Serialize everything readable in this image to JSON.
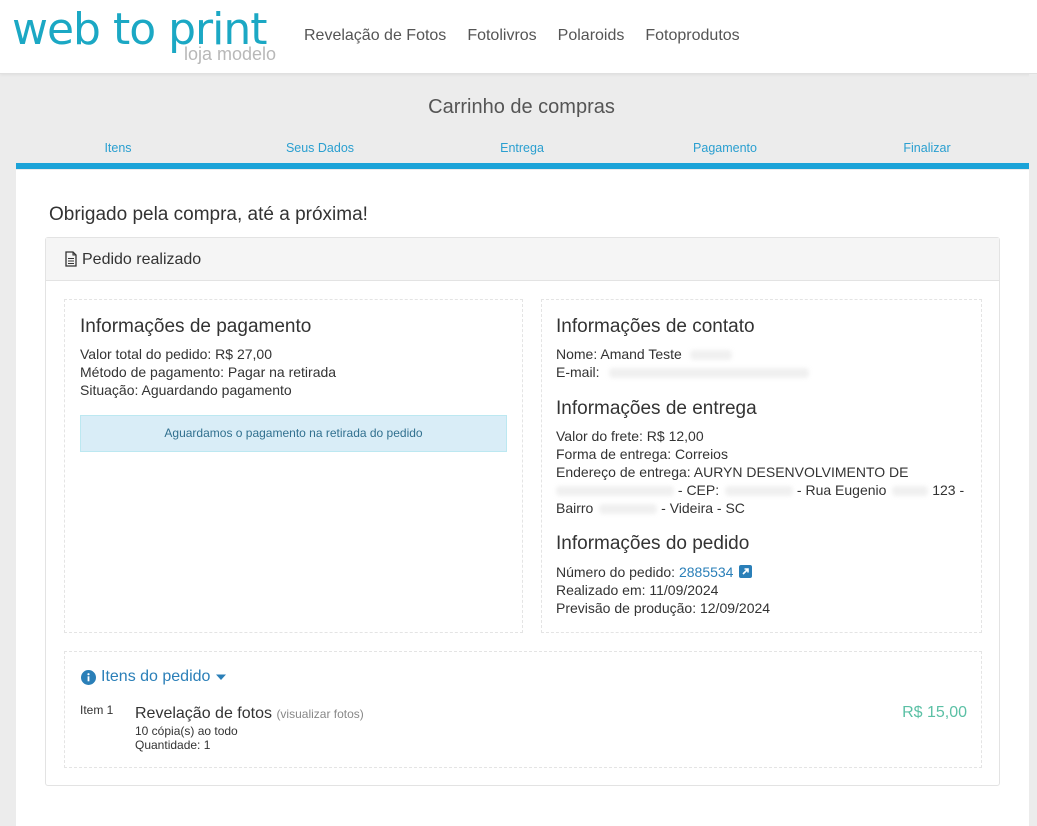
{
  "header": {
    "logo_text": "web to print",
    "logo_subtitle": "loja modelo",
    "nav": [
      "Revelação de Fotos",
      "Fotolivros",
      "Polaroids",
      "Fotoprodutos"
    ]
  },
  "cart": {
    "title": "Carrinho de compras",
    "steps": [
      "Itens",
      "Seus Dados",
      "Entrega",
      "Pagamento",
      "Finalizar"
    ]
  },
  "order": {
    "thanks": "Obrigado pela compra, até a próxima!",
    "panel_title": "Pedido realizado",
    "payment": {
      "title": "Informações de pagamento",
      "total": "Valor total do pedido: R$ 27,00",
      "method": "Método de pagamento: Pagar na retirada",
      "status": "Situação: Aguardando pagamento",
      "alert": "Aguardamos o pagamento na retirada do pedido"
    },
    "contact": {
      "title": "Informações de contato",
      "name": "Nome: Amand Teste",
      "email": "E-mail:"
    },
    "delivery": {
      "title": "Informações de entrega",
      "freight": "Valor do frete: R$ 12,00",
      "method": "Forma de entrega: Correios",
      "address_line1": "Endereço de entrega: AURYN DESENVOLVIMENTO DE",
      "address_cep": "- CEP:",
      "address_street": "- Rua Eugenio",
      "address_number": "123 -",
      "address_bairro": "Bairro",
      "address_city": "- Videira - SC"
    },
    "info": {
      "title": "Informações do pedido",
      "number_label": "Número do pedido:",
      "number": "2885534",
      "date": "Realizado em: 11/09/2024",
      "forecast": "Previsão de produção: 12/09/2024"
    },
    "items": {
      "toggle_label": "Itens do pedido",
      "list": [
        {
          "num": "Item 1",
          "name": "Revelação de fotos",
          "view_link": "(visualizar fotos)",
          "copies": "10 cópia(s) ao todo",
          "quantity": "Quantidade: 1",
          "price": "R$ 15,00"
        }
      ]
    }
  },
  "colors": {
    "brand": "#1ba8c4",
    "step_bar": "#1ba3d8",
    "link": "#2a7fb8",
    "price": "#5bc0a5",
    "alert_bg": "#d9edf7"
  },
  "icons": [
    "document-icon",
    "external-link-icon",
    "info-circle-icon",
    "caret-down-icon"
  ]
}
